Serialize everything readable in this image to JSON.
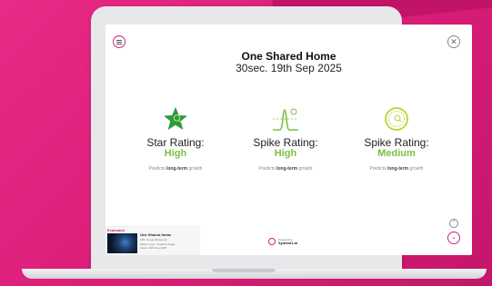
{
  "header": {
    "title": "One Shared Home",
    "subtitle": "30sec. 19th Sep 2025"
  },
  "ratings": [
    {
      "label": "Star Rating:",
      "level": "High",
      "desc_pre": "Predicts ",
      "desc_bold": "long-term",
      "desc_post": " growth",
      "icon": "star-icon"
    },
    {
      "label": "Spike Rating:",
      "level": "High",
      "desc_pre": "Predicts ",
      "desc_bold": "long-term",
      "desc_post": " growth",
      "icon": "spike-chart-icon"
    },
    {
      "label": "Spike Rating:",
      "level": "Medium",
      "desc_pre": "Predicts ",
      "desc_bold": "long-term",
      "desc_post": " growth",
      "icon": "medal-icon"
    }
  ],
  "thumbnail": {
    "tag": "Evaluated",
    "title": "One Shared home",
    "line1": "ABC Group Media Ltd.",
    "line2": "Motion Type: Creative Image",
    "line3": "Views: 19th Sep 2025"
  },
  "powered": {
    "small": "Powered by",
    "brand": "System1.ai"
  },
  "colors": {
    "accent": "#d0207a",
    "level": "#7bc144",
    "background": "#e7237f"
  }
}
